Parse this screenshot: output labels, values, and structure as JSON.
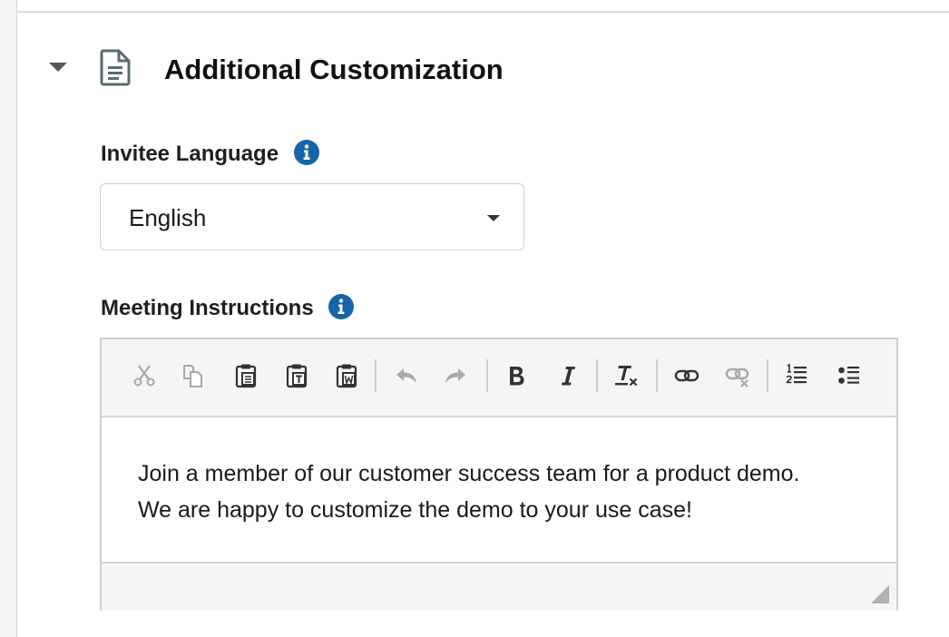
{
  "section": {
    "title": "Additional Customization",
    "toggle_icon": "caret-down-icon",
    "icon": "document-icon"
  },
  "invitee_language": {
    "label": "Invitee Language",
    "info_icon": "info-icon",
    "selected": "English"
  },
  "meeting_instructions": {
    "label": "Meeting Instructions",
    "info_icon": "info-icon",
    "content_lines": [
      "Join a member of our customer success team for a product demo.",
      "We are happy to customize the demo to your use case!"
    ],
    "toolbar": [
      {
        "name": "cut",
        "icon": "scissors-icon",
        "enabled": false
      },
      {
        "name": "copy",
        "icon": "copy-icon",
        "enabled": false
      },
      {
        "name": "paste",
        "icon": "paste-icon",
        "enabled": true
      },
      {
        "name": "paste-text",
        "icon": "paste-text-icon",
        "enabled": true
      },
      {
        "name": "paste-word",
        "icon": "paste-word-icon",
        "enabled": true
      },
      {
        "name": "undo",
        "icon": "undo-icon",
        "enabled": false
      },
      {
        "name": "redo",
        "icon": "redo-icon",
        "enabled": false
      },
      {
        "name": "bold",
        "icon": "bold-icon",
        "enabled": true
      },
      {
        "name": "italic",
        "icon": "italic-icon",
        "enabled": true
      },
      {
        "name": "remove-format",
        "icon": "remove-format-icon",
        "enabled": true
      },
      {
        "name": "link",
        "icon": "link-icon",
        "enabled": true
      },
      {
        "name": "unlink",
        "icon": "unlink-icon",
        "enabled": false
      },
      {
        "name": "numbered-list",
        "icon": "numbered-list-icon",
        "enabled": true
      },
      {
        "name": "bulleted-list",
        "icon": "bulleted-list-icon",
        "enabled": true
      }
    ]
  },
  "colors": {
    "info_blue": "#1565a8",
    "icon_gray": "#5a6b6e",
    "disabled_gray": "#a8a8a8",
    "enabled_dark": "#333333"
  }
}
